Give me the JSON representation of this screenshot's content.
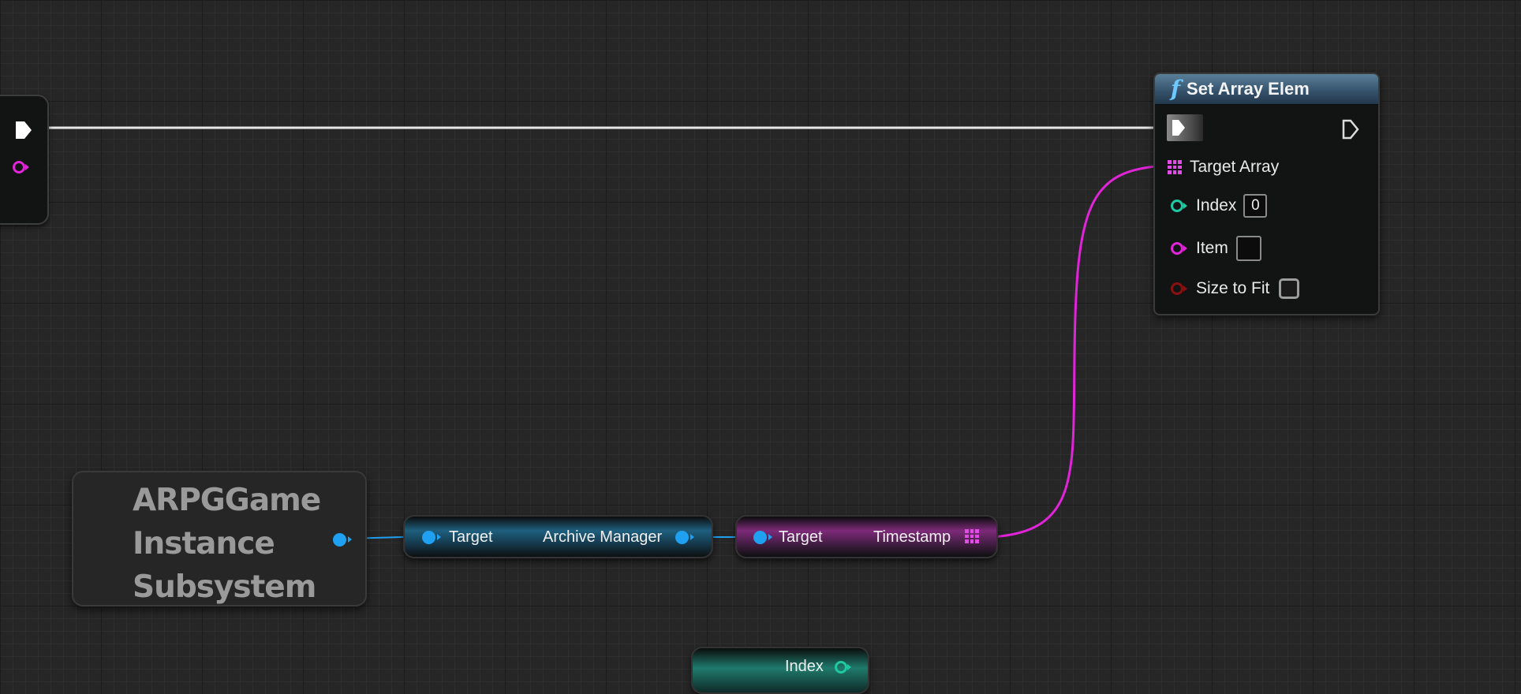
{
  "canvas": {
    "background": "#262626",
    "exec_wire_color": "#e6e6e6",
    "object_wire_color": "#1fa0f0",
    "array_wire_color": "#e024d8"
  },
  "set_array_elem": {
    "title": "Set Array Elem",
    "icon": "function-f-icon",
    "header_color": "#3f5f78",
    "pins": {
      "target_array": "Target Array",
      "index": "Index",
      "index_value": "0",
      "item": "Item",
      "item_value": "",
      "size_to_fit": "Size to Fit",
      "size_to_fit_checked": false
    }
  },
  "subsystem_node": {
    "title_line1": "ARPGGame",
    "title_line2": "Instance",
    "title_line3": "Subsystem"
  },
  "archive_node": {
    "input": "Target",
    "output": "Archive Manager",
    "color": "#1e5f7e"
  },
  "timestamp_node": {
    "input": "Target",
    "output": "Timestamp",
    "color": "#7d2a79"
  },
  "partial_bottom_node": {
    "label": "Index",
    "color": "#1f7a6c"
  }
}
